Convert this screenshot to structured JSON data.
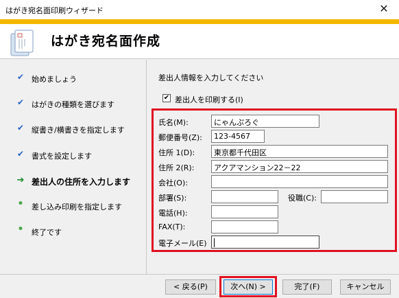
{
  "window": {
    "title": "はがき宛名面印刷ウィザード"
  },
  "header": {
    "title": "はがき宛名面作成",
    "logo_icon": "postcard-wizard-icon"
  },
  "sidebar": {
    "steps": [
      {
        "label": "始めましょう",
        "status": "done"
      },
      {
        "label": "はがきの種類を選びます",
        "status": "done"
      },
      {
        "label": "縦書き/横書きを指定します",
        "status": "done"
      },
      {
        "label": "書式を設定します",
        "status": "done"
      },
      {
        "label": "差出人の住所を入力します",
        "status": "current"
      },
      {
        "label": "差し込み印刷を指定します",
        "status": "pending"
      },
      {
        "label": "終了です",
        "status": "pending"
      }
    ]
  },
  "main": {
    "heading": "差出人情報を入力してください",
    "print_sender": {
      "label": "差出人を印刷する(I)",
      "checked": true
    },
    "fields": {
      "name": {
        "label": "氏名(M):",
        "value": "にゃんぷろぐ"
      },
      "postal": {
        "label": "郵便番号(Z):",
        "value": "123-4567"
      },
      "address1": {
        "label": "住所 1(D):",
        "value": "東京都千代田区"
      },
      "address2": {
        "label": "住所 2(R):",
        "value": "アクアマンション22－22"
      },
      "company": {
        "label": "会社(O):",
        "value": ""
      },
      "department": {
        "label": "部署(S):",
        "value": ""
      },
      "title": {
        "label": "役職(C):",
        "value": ""
      },
      "phone": {
        "label": "電話(H):",
        "value": ""
      },
      "fax": {
        "label": "FAX(T):",
        "value": ""
      },
      "email": {
        "label": "電子メール(E)",
        "value": ""
      }
    }
  },
  "footer": {
    "back": "< 戻る(P)",
    "next": "次へ(N) >",
    "finish": "完了(F)",
    "cancel": "キャンセル"
  },
  "colors": {
    "accent": "#f5b800",
    "highlight": "#e01020",
    "check": "#2a64c6",
    "dot": "#4aa84a"
  }
}
